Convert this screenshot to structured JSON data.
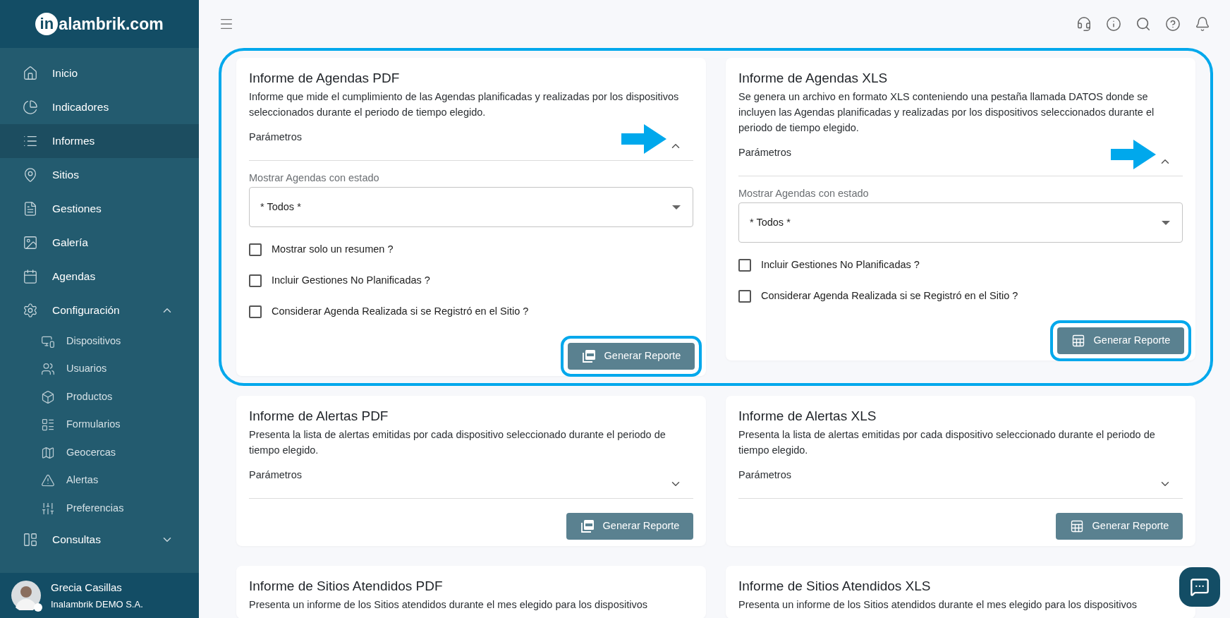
{
  "logo": {
    "badge": "in",
    "text": "alambrik.com"
  },
  "sidebar": {
    "items": [
      {
        "label": "Inicio",
        "selected": false
      },
      {
        "label": "Indicadores",
        "selected": false
      },
      {
        "label": "Informes",
        "selected": true
      },
      {
        "label": "Sitios",
        "selected": false
      },
      {
        "label": "Gestiones",
        "selected": false
      },
      {
        "label": "Galería",
        "selected": false
      },
      {
        "label": "Agendas",
        "selected": false
      },
      {
        "label": "Configuración",
        "selected": false,
        "expanded": true,
        "children": [
          {
            "label": "Dispositivos",
            "selected": false
          },
          {
            "label": "Usuarios",
            "selected": false
          },
          {
            "label": "Productos",
            "selected": false
          },
          {
            "label": "Formularios",
            "selected": false
          },
          {
            "label": "Geocercas",
            "selected": false
          },
          {
            "label": "Alertas",
            "selected": false
          },
          {
            "label": "Preferencias",
            "selected": false
          }
        ]
      },
      {
        "label": "Consultas",
        "selected": false,
        "expanded": false
      }
    ]
  },
  "user": {
    "name": "Grecia Casillas",
    "company": "Inalambrik DEMO S.A."
  },
  "rows": [
    {
      "highlighted": true,
      "cards": [
        {
          "kind": "pdf",
          "title": "Informe de Agendas PDF",
          "description": "Informe que mide el cumplimiento de las Agendas planificadas y realizadas por los dispositivos seleccionados durante el periodo de tiempo elegido.",
          "params_label": "Parámetros",
          "expanded": true,
          "annotated": true,
          "status_label": "Mostrar Agendas con estado",
          "status_value": "* Todos *",
          "checkboxes": [
            {
              "label": "Mostrar solo un resumen ?",
              "checked": false
            },
            {
              "label": "Incluir Gestiones No Planificadas ?",
              "checked": false
            },
            {
              "label": "Considerar Agenda Realizada si se Registró en el Sitio ?",
              "checked": false
            }
          ],
          "button": "Generar Reporte"
        },
        {
          "kind": "xls",
          "title": "Informe de Agendas XLS",
          "description": "Se genera un archivo en formato XLS conteniendo una pestaña llamada DATOS donde se incluyen las Agendas planificadas y realizadas por los dispositivos seleccionados durante el periodo de tiempo elegido.",
          "params_label": "Parámetros",
          "expanded": true,
          "annotated": true,
          "status_label": "Mostrar Agendas con estado",
          "status_value": "* Todos *",
          "checkboxes": [
            {
              "label": "Incluir Gestiones No Planificadas ?",
              "checked": false
            },
            {
              "label": "Considerar Agenda Realizada si se Registró en el Sitio ?",
              "checked": false
            }
          ],
          "button": "Generar Reporte"
        }
      ]
    },
    {
      "highlighted": false,
      "cards": [
        {
          "kind": "pdf",
          "title": "Informe de Alertas PDF",
          "description": "Presenta la lista de alertas emitidas por cada dispositivo seleccionado durante el periodo de tiempo elegido.",
          "params_label": "Parámetros",
          "expanded": false,
          "annotated": false,
          "button": "Generar Reporte"
        },
        {
          "kind": "xls",
          "title": "Informe de Alertas XLS",
          "description": "Presenta la lista de alertas emitidas por cada dispositivo seleccionado durante el periodo de tiempo elegido.",
          "params_label": "Parámetros",
          "expanded": false,
          "annotated": false,
          "button": "Generar Reporte"
        }
      ]
    },
    {
      "highlighted": false,
      "cards": [
        {
          "title": "Informe de Sitios Atendidos PDF",
          "description": "Presenta un informe de los Sitios atendidos durante el mes elegido para los dispositivos"
        },
        {
          "title": "Informe de Sitios Atendidos XLS",
          "description": "Presenta un informe de los Sitios atendidos durante el mes elegido para los dispositivos"
        }
      ]
    }
  ]
}
